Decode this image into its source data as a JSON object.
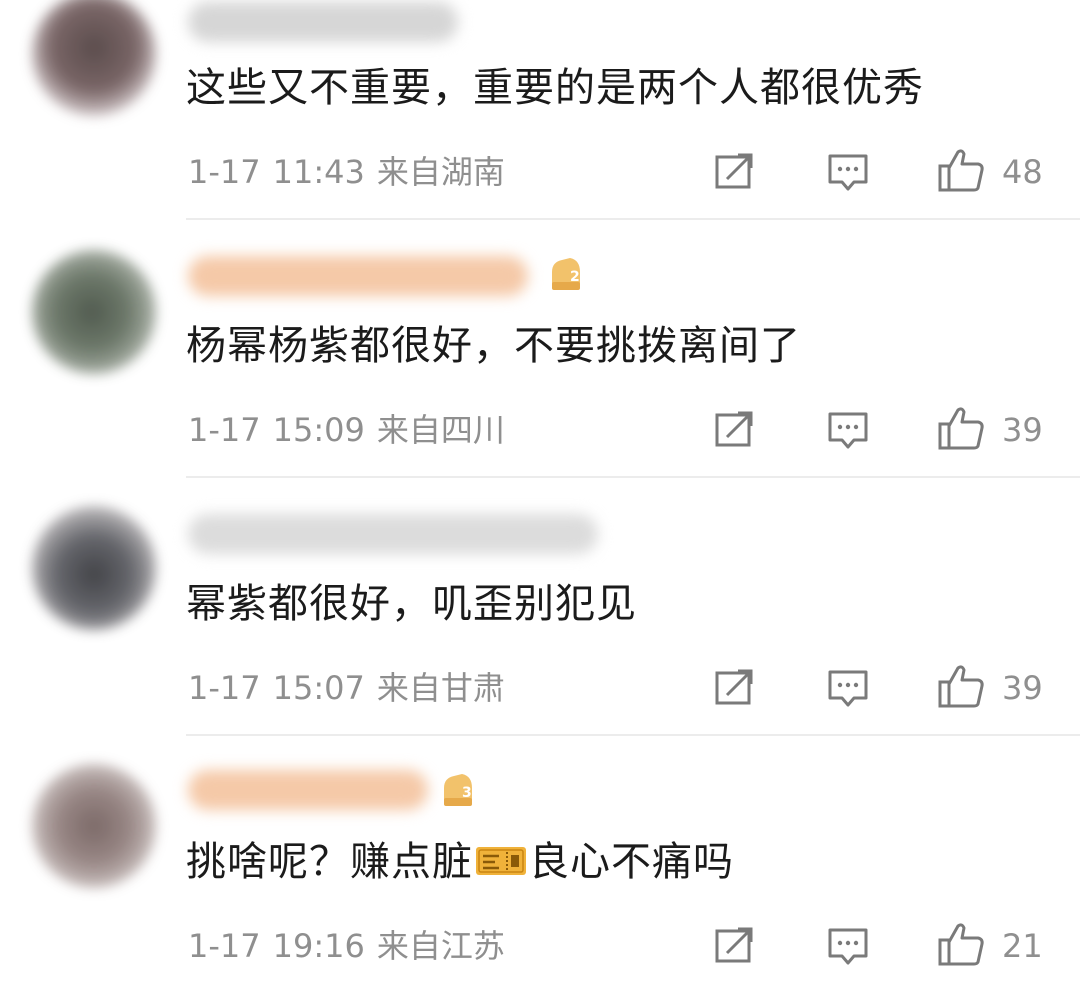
{
  "comments": [
    {
      "text": "这些又不重要，重要的是两个人都很优秀",
      "date": "1-17",
      "time": "11:43",
      "location": "来自湖南",
      "likes": "48"
    },
    {
      "text": "杨幂杨紫都很好，不要挑拨离间了",
      "date": "1-17",
      "time": "15:09",
      "location": "来自四川",
      "likes": "39"
    },
    {
      "text": "幂紫都很好，叽歪别犯见",
      "date": "1-17",
      "time": "15:07",
      "location": "来自甘肃",
      "likes": "39"
    },
    {
      "text_before": "挑啥呢？赚点脏",
      "text_after": "良心不痛吗",
      "date": "1-17",
      "time": "19:16",
      "location": "来自江苏",
      "likes": "21"
    }
  ],
  "icons": {
    "share": "share-icon",
    "reply": "comment-icon",
    "like": "thumbs-up-icon",
    "badge": "fan-level-badge-icon",
    "money": "ticket-emoji-icon"
  },
  "colors": {
    "meta_text": "#8f8f8f",
    "icon_stroke": "#7a7a7a",
    "name_blur": "#f5c9a8"
  }
}
